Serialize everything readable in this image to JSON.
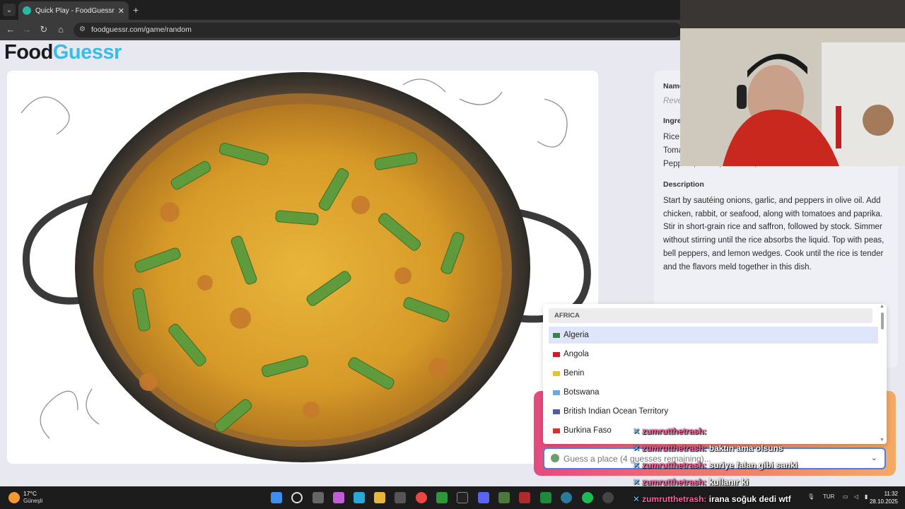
{
  "browser": {
    "tab_title": "Quick Play - FoodGuessr | Food Geography Game",
    "tab_close": "✕",
    "new_tab": "+",
    "url": "foodguessr.com/game/random"
  },
  "page": {
    "logo_part1": "Food",
    "logo_part2": "Guessr",
    "name_label": "Name",
    "name_value": "Reve",
    "ingredients_label": "Ingre",
    "ingredients_lines": [
      "Rice,",
      "Toma",
      "Peppers, Garlic, Olive Oil, Saffron"
    ],
    "description_label": "Description",
    "description_text": "Start by sautéing onions, garlic, and peppers in olive oil. Add chicken, rabbit, or seafood, along with tomatoes and paprika. Stir in short-grain rice and saffron, followed by stock. Simmer without stirring until the rice absorbs the liquid. Top with peas, bell peppers, and lemon wedges. Cook until the rice is tender and the flavors meld together in this dish."
  },
  "dropdown": {
    "group_label": "AFRICA",
    "items": [
      {
        "label": "Algeria",
        "flag_color": "#2f8a3c"
      },
      {
        "label": "Angola",
        "flag_color": "#c8202a"
      },
      {
        "label": "Benin",
        "flag_color": "#e8c516"
      },
      {
        "label": "Botswana",
        "flag_color": "#6ea9d8"
      },
      {
        "label": "British Indian Ocean Territory",
        "flag_color": "#4b5ea8"
      },
      {
        "label": "Burkina Faso",
        "flag_color": "#d0342c"
      }
    ],
    "selected_index": 0
  },
  "guess": {
    "placeholder": "Guess a place (4 guesses remaining)..."
  },
  "chat": [
    {
      "user": "zumrutthetrash:",
      "msg": ""
    },
    {
      "user": "zumrutthetrash:",
      "msg": "baktın ama olsuns"
    },
    {
      "user": "zumrutthetrash:",
      "msg": "suriye falan gibi sanki"
    },
    {
      "user": "zumrutthetrash:",
      "msg": "kullanır ki"
    },
    {
      "user": "zumrutthetrash:",
      "msg": "irana soğuk dedi wtf"
    }
  ],
  "taskbar": {
    "weather_temp": "17°C",
    "weather_desc": "Güneşli",
    "lang": "TUR",
    "time": "11:32",
    "date": "28.10.2025"
  },
  "colors": {
    "logo_accent": "#38bde8",
    "guess_gradient_start": "#e64a7e",
    "guess_gradient_end": "#f3aa64",
    "chat_user": "#ff5fa0"
  }
}
